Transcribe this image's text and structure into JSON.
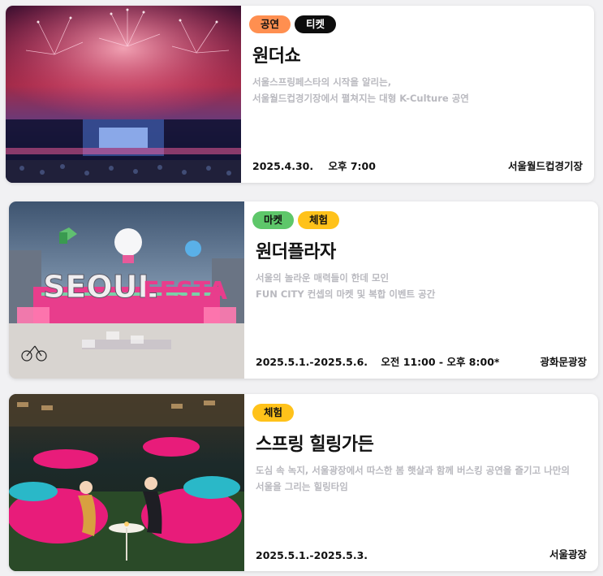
{
  "cards": [
    {
      "tags": [
        {
          "label": "공연",
          "bg": "#ff8f50",
          "fg": "#111111"
        },
        {
          "label": "티켓",
          "bg": "#0d0d0d",
          "fg": "#ffffff"
        }
      ],
      "title": "원더쇼",
      "desc": [
        "서울스프링페스타의 시작을 알리는,",
        "서울월드컵경기장에서 펼쳐지는 대형 K-Culture 공연"
      ],
      "date": "2025.4.30.",
      "time": "오후 7:00",
      "place": "서울월드컵경기장",
      "image": "fireworks-stadium-concert"
    },
    {
      "tags": [
        {
          "label": "마켓",
          "bg": "#5ec76a",
          "fg": "#111111"
        },
        {
          "label": "체험",
          "bg": "#ffc21a",
          "fg": "#111111"
        }
      ],
      "title": "원더플라자",
      "desc": [
        "서울의 놀라운 매력들이 한데 모인",
        "FUN CITY 컨셉의 마켓 및 복합 이벤트 공간"
      ],
      "date": "2025.5.1.-2025.5.6.",
      "time": "오전 11:00 - 오후 8:00*",
      "place": "광화문광장",
      "image": "seoul-spring-festa-plaza",
      "image_text": "SEOUL SPRING FESTA"
    },
    {
      "tags": [
        {
          "label": "체험",
          "bg": "#ffc21a",
          "fg": "#111111"
        }
      ],
      "title": "스프링 힐링가든",
      "desc": [
        "도심 속 녹지, 서울광장에서 따스한 봄 햇살과 함께 버스킹 공연을 즐기고 나만의",
        "서울을 그리는 힐링타임"
      ],
      "date": "2025.5.1.-2025.5.3.",
      "time": "",
      "place": "서울광장",
      "image": "beanbag-garden-night"
    }
  ]
}
